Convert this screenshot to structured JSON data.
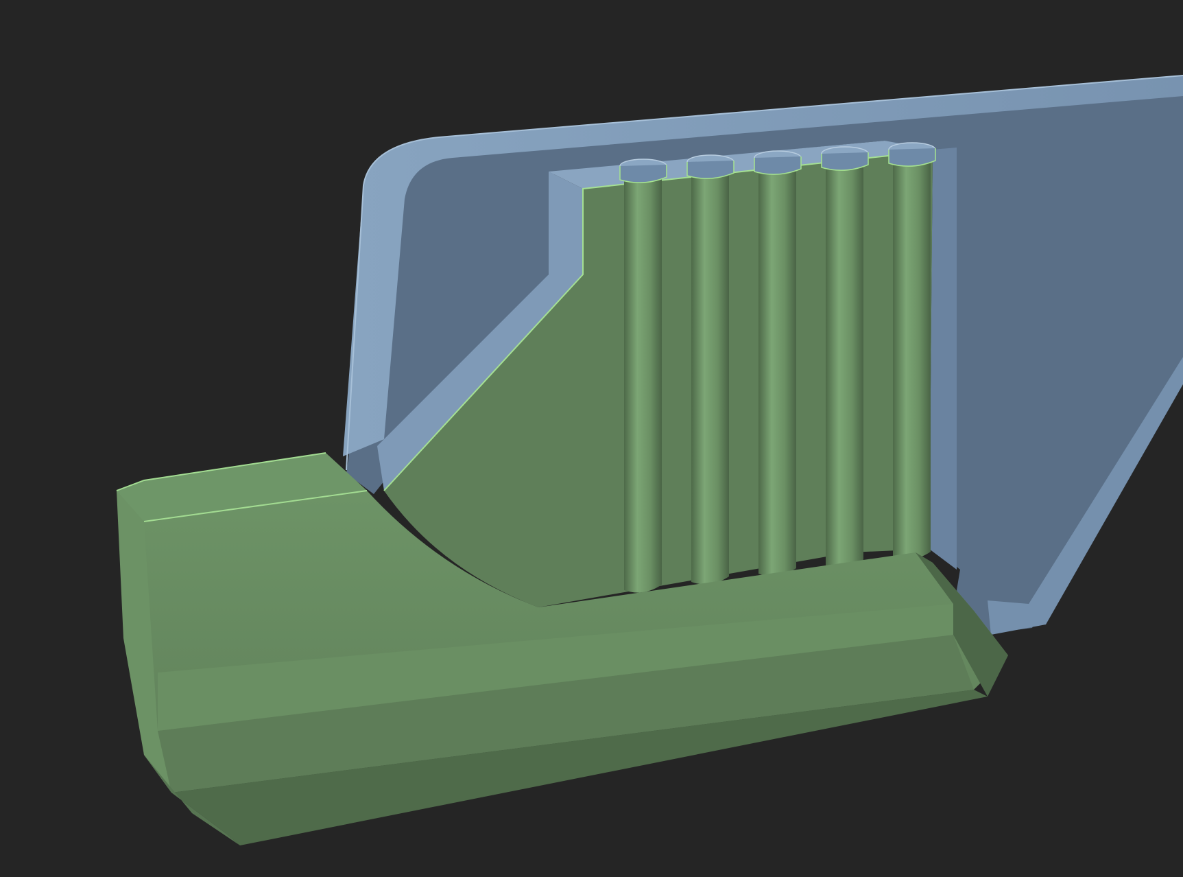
{
  "scene": {
    "background_color": "#252525",
    "colors": {
      "blue_face": "#5a6f87",
      "blue_bevel": "#7d98b4",
      "blue_dark": "#4a5c72",
      "green_face": "#62805c",
      "green_light": "#76a070",
      "green_dark": "#4a6446",
      "green_edge": "#9fd890"
    },
    "ridge_count": 5
  }
}
